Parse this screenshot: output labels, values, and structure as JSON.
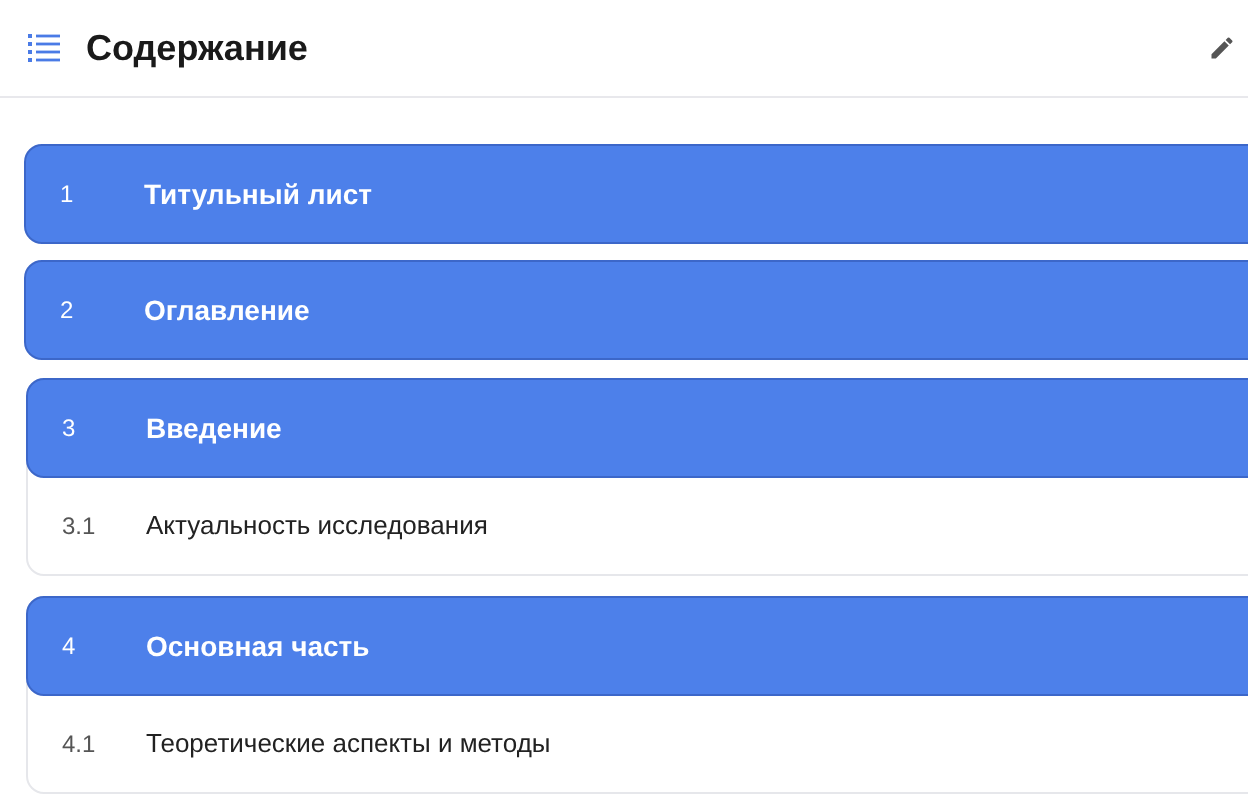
{
  "header": {
    "title": "Содержание"
  },
  "sections": [
    {
      "number": "1",
      "title": "Титульный лист"
    },
    {
      "number": "2",
      "title": "Оглавление"
    },
    {
      "number": "3",
      "title": "Введение",
      "children": [
        {
          "number": "3.1",
          "title": "Актуальность исследования"
        }
      ]
    },
    {
      "number": "4",
      "title": "Основная часть",
      "children": [
        {
          "number": "4.1",
          "title": "Теоретические аспекты и методы"
        }
      ]
    }
  ]
}
